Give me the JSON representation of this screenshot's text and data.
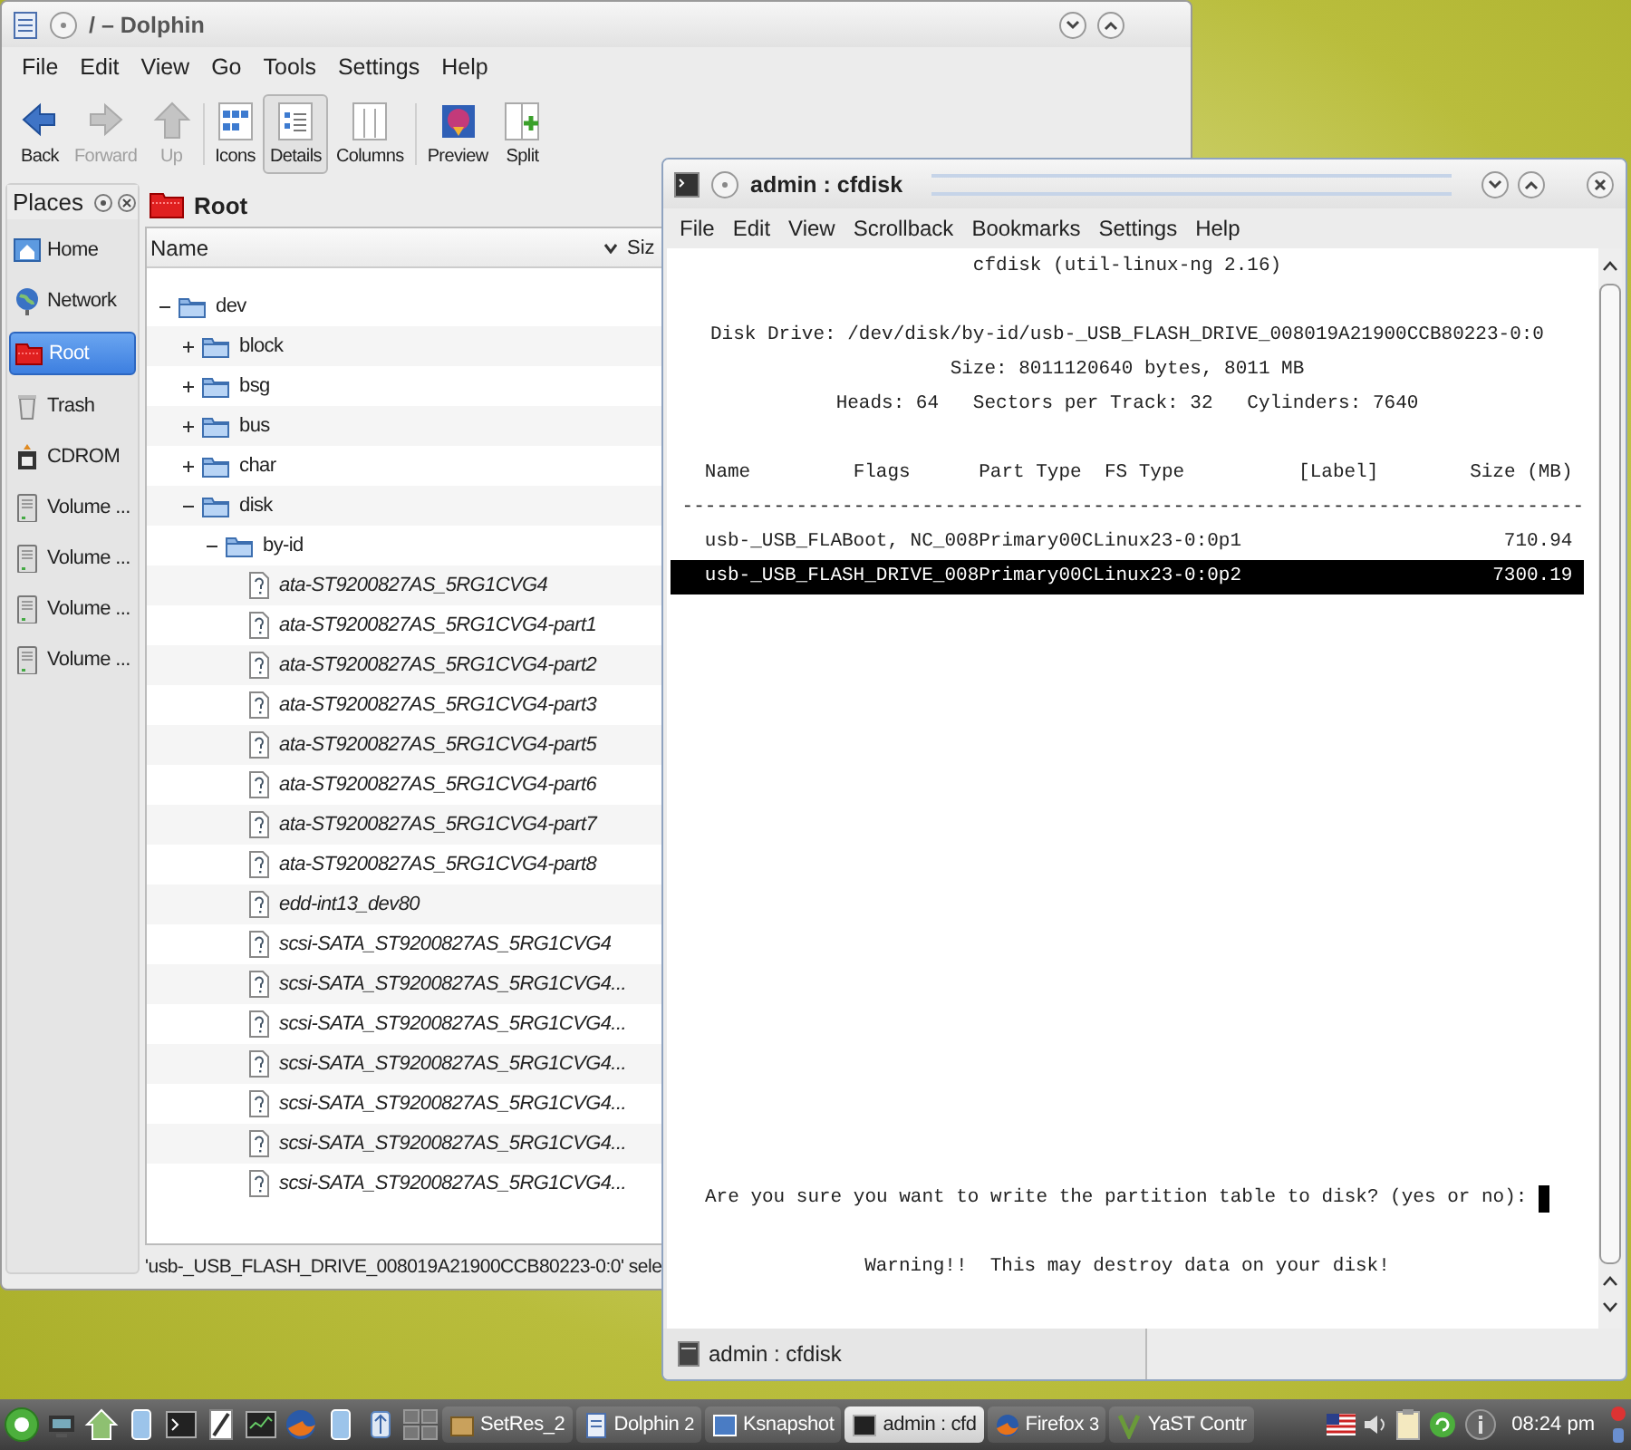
{
  "dolphin": {
    "title": "/ – Dolphin",
    "menu": [
      "File",
      "Edit",
      "View",
      "Go",
      "Tools",
      "Settings",
      "Help"
    ],
    "toolbar": [
      {
        "label": "Back",
        "kind": "back",
        "disabled": false,
        "selected": false
      },
      {
        "label": "Forward",
        "kind": "forward",
        "disabled": true,
        "selected": false
      },
      {
        "label": "Up",
        "kind": "up",
        "disabled": true,
        "selected": false
      },
      {
        "label": "Icons",
        "kind": "icons",
        "disabled": false,
        "selected": false
      },
      {
        "label": "Details",
        "kind": "details",
        "disabled": false,
        "selected": true
      },
      {
        "label": "Columns",
        "kind": "columns",
        "disabled": false,
        "selected": false
      },
      {
        "label": "Preview",
        "kind": "preview",
        "disabled": false,
        "selected": false
      },
      {
        "label": "Split",
        "kind": "split",
        "disabled": false,
        "selected": false
      }
    ],
    "places_title": "Places",
    "places": [
      {
        "label": "Home",
        "kind": "home",
        "selected": false
      },
      {
        "label": "Network",
        "kind": "network",
        "selected": false
      },
      {
        "label": "Root",
        "kind": "root",
        "selected": true
      },
      {
        "label": "Trash",
        "kind": "trash",
        "selected": false
      },
      {
        "label": "CDROM",
        "kind": "cdrom",
        "selected": false
      },
      {
        "label": "Volume ...",
        "kind": "volume",
        "selected": false
      },
      {
        "label": "Volume ...",
        "kind": "volume",
        "selected": false
      },
      {
        "label": "Volume ...",
        "kind": "volume",
        "selected": false
      },
      {
        "label": "Volume ...",
        "kind": "volume",
        "selected": false
      }
    ],
    "breadcrumb": "Root",
    "columns": [
      "Name",
      "Siz"
    ],
    "tree": [
      {
        "name": "dev",
        "kind": "folder",
        "expanded": true,
        "children": [
          {
            "name": "block",
            "kind": "folder",
            "expanded": false
          },
          {
            "name": "bsg",
            "kind": "folder",
            "expanded": false
          },
          {
            "name": "bus",
            "kind": "folder",
            "expanded": false
          },
          {
            "name": "char",
            "kind": "folder",
            "expanded": false
          },
          {
            "name": "disk",
            "kind": "folder",
            "expanded": true,
            "children": [
              {
                "name": "by-id",
                "kind": "folder",
                "expanded": true,
                "children": [
                  {
                    "name": "ata-ST9200827AS_5RG1CVG4",
                    "kind": "symlink"
                  },
                  {
                    "name": "ata-ST9200827AS_5RG1CVG4-part1",
                    "kind": "symlink"
                  },
                  {
                    "name": "ata-ST9200827AS_5RG1CVG4-part2",
                    "kind": "symlink"
                  },
                  {
                    "name": "ata-ST9200827AS_5RG1CVG4-part3",
                    "kind": "symlink"
                  },
                  {
                    "name": "ata-ST9200827AS_5RG1CVG4-part5",
                    "kind": "symlink"
                  },
                  {
                    "name": "ata-ST9200827AS_5RG1CVG4-part6",
                    "kind": "symlink"
                  },
                  {
                    "name": "ata-ST9200827AS_5RG1CVG4-part7",
                    "kind": "symlink"
                  },
                  {
                    "name": "ata-ST9200827AS_5RG1CVG4-part8",
                    "kind": "symlink"
                  },
                  {
                    "name": "edd-int13_dev80",
                    "kind": "symlink"
                  },
                  {
                    "name": "scsi-SATA_ST9200827AS_5RG1CVG4",
                    "kind": "symlink"
                  },
                  {
                    "name": "scsi-SATA_ST9200827AS_5RG1CVG4...",
                    "kind": "symlink"
                  },
                  {
                    "name": "scsi-SATA_ST9200827AS_5RG1CVG4...",
                    "kind": "symlink"
                  },
                  {
                    "name": "scsi-SATA_ST9200827AS_5RG1CVG4...",
                    "kind": "symlink"
                  },
                  {
                    "name": "scsi-SATA_ST9200827AS_5RG1CVG4...",
                    "kind": "symlink"
                  },
                  {
                    "name": "scsi-SATA_ST9200827AS_5RG1CVG4...",
                    "kind": "symlink"
                  },
                  {
                    "name": "scsi-SATA_ST9200827AS_5RG1CVG4...",
                    "kind": "symlink"
                  }
                ]
              }
            ]
          }
        ]
      }
    ],
    "status": "'usb-_USB_FLASH_DRIVE_008019A21900CCB80223-0:0' sele"
  },
  "terminal": {
    "title": "admin : cfdisk",
    "menu": [
      "File",
      "Edit",
      "View",
      "Scrollback",
      "Bookmarks",
      "Settings",
      "Help"
    ],
    "lines": [
      {
        "kind": "center",
        "text": "cfdisk (util-linux-ng 2.16)"
      },
      {
        "kind": "blank"
      },
      {
        "kind": "center",
        "text": "Disk Drive: /dev/disk/by-id/usb-_USB_FLASH_DRIVE_008019A21900CCB80223-0:0"
      },
      {
        "kind": "center",
        "text": "Size: 8011120640 bytes, 8011 MB"
      },
      {
        "kind": "center",
        "text": "Heads: 64   Sectors per Track: 32   Cylinders: 7640"
      },
      {
        "kind": "blank"
      },
      {
        "kind": "pre",
        "text": "   Name         Flags      Part Type  FS Type          [Label]        Size (MB)"
      },
      {
        "kind": "pre",
        "text": " -------------------------------------------------------------------------------"
      },
      {
        "kind": "partition",
        "text": "usb-_USB_FLABoot, NC_008Primary00CLinux23-0:0p1",
        "size": "710.94",
        "selected": false
      },
      {
        "kind": "partition",
        "text": "usb-_USB_FLASH_DRIVE_008Primary00CLinux23-0:0p2",
        "size": "7300.19",
        "selected": true
      }
    ],
    "prompt": "Are you sure you want to write the partition table to disk? (yes or no): ",
    "warning": "Warning!!  This may destroy data on your disk!",
    "tab": "admin : cfdisk"
  },
  "taskbar": {
    "tasks": [
      {
        "label": "SetRes_2",
        "kind": "package",
        "selected": false
      },
      {
        "label": "Dolphin",
        "kind": "dolphin",
        "count": "2",
        "selected": false
      },
      {
        "label": "Ksnapshot",
        "kind": "snapshot",
        "selected": false
      },
      {
        "label": "admin : cfd",
        "kind": "terminal",
        "selected": true
      },
      {
        "label": "Firefox",
        "kind": "firefox",
        "count": "3",
        "selected": false
      },
      {
        "label": "YaST Contr",
        "kind": "yast",
        "selected": false
      }
    ],
    "clock": "08:24 pm"
  }
}
